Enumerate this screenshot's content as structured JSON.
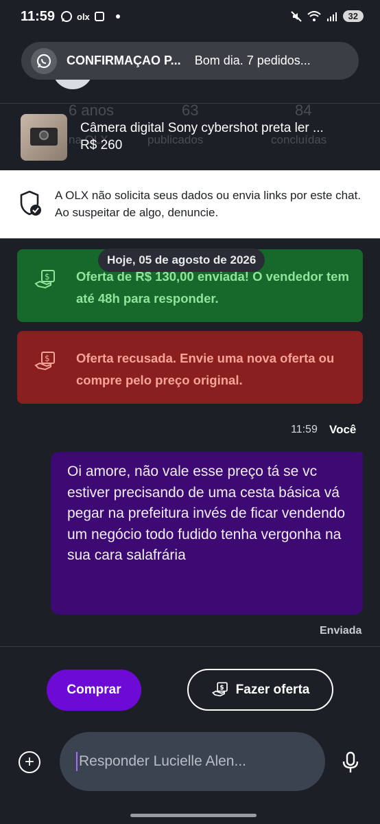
{
  "status_bar": {
    "time": "11:59",
    "left_text": "olx",
    "battery": "32"
  },
  "notification": {
    "title": "CONFIRMAÇAO P...",
    "body": "Bom dia.  7 pedidos..."
  },
  "background_profile": {
    "stats": [
      {
        "value": "6 anos",
        "label": "na OLX"
      },
      {
        "value": "63",
        "label": "publicados"
      },
      {
        "value": "84",
        "label": "concluídas"
      }
    ]
  },
  "product": {
    "title": "Câmera digital Sony cybershot preta ler ...",
    "price": "R$ 260"
  },
  "safety_notice": {
    "text": "A OLX não solicita seus dados ou envia links por este chat. Ao suspeitar de algo, denuncie."
  },
  "date_chip": "Hoje, 05 de agosto de 2026",
  "offers": [
    {
      "text": "Oferta de R$ 130,00 enviada! O vendedor tem até 48h para responder.",
      "status": "sent"
    },
    {
      "text": "Oferta recusada. Envie uma nova oferta ou compre pelo preço original.",
      "status": "declined"
    }
  ],
  "message": {
    "time": "11:59",
    "author": "Você",
    "text": "Oi amore, não vale esse preço tá se vc estiver precisando de uma cesta básica vá pegar na prefeitura invés de ficar vendendo um negócio todo fudido tenha vergonha na sua cara salafrária",
    "status": "Enviada"
  },
  "actions": {
    "buy_label": "Comprar",
    "offer_label": "Fazer oferta"
  },
  "composer": {
    "placeholder": "Responder Lucielle Alen..."
  },
  "colors": {
    "background": "#1c1f26",
    "purple": "#6e0ad6",
    "bubble": "#3c0a72",
    "offer_sent_bg": "#16692b",
    "offer_declined_bg": "#8a1f1f"
  }
}
